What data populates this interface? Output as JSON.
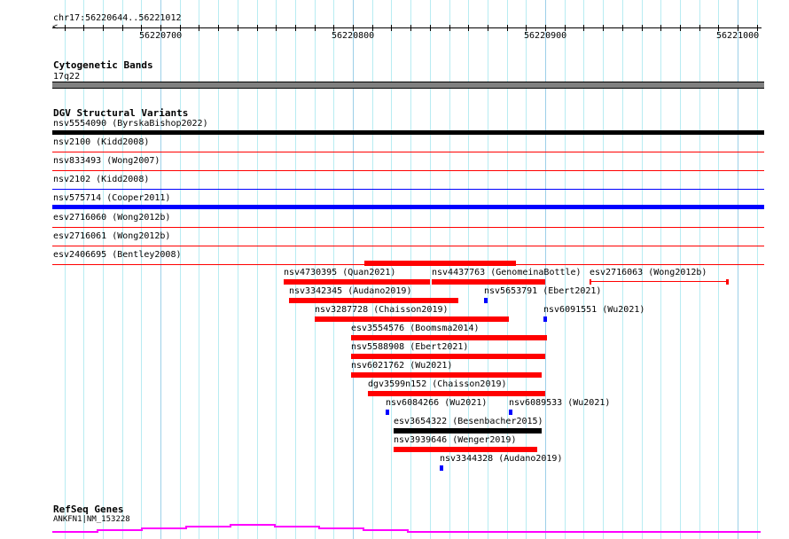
{
  "ruler": {
    "location": "chr17:56220644..56221012",
    "start": 56220644,
    "end": 56221012,
    "labels": [
      "56220700",
      "56220800",
      "56220900",
      "56221000"
    ]
  },
  "cytobands": {
    "title": "Cytogenetic Bands",
    "band": "17q22",
    "color": "#808080"
  },
  "dgv": {
    "title": "DGV Structural Variants",
    "full_rows": [
      {
        "label": "nsv5554090 (ByrskaBishop2022)",
        "color": "#000000",
        "style": "thick"
      },
      {
        "label": "nsv2100 (Kidd2008)",
        "color": "#ff0000",
        "style": "line"
      },
      {
        "label": "nsv833493 (Wong2007)",
        "color": "#ff0000",
        "style": "line"
      },
      {
        "label": "nsv2102 (Kidd2008)",
        "color": "#0000ff",
        "style": "line"
      },
      {
        "label": "nsv575714 (Cooper2011)",
        "color": "#0000ff",
        "style": "thick"
      },
      {
        "label": "esv2716060 (Wong2012b)",
        "color": "#ff0000",
        "style": "line"
      },
      {
        "label": "esv2716061 (Wong2012b)",
        "color": "#ff0000",
        "style": "line"
      },
      {
        "label": "esv2406695 (Bentley2008)",
        "color": "#ff0000",
        "style": "line"
      }
    ],
    "features": [
      {
        "label": "",
        "start": 56220806,
        "end": 56220885,
        "row": -1,
        "color": "#ff0000"
      },
      {
        "label": "nsv4730395 (Quan2021)",
        "start": 56220764,
        "end": 56220840,
        "row": 0,
        "color": "#ff0000"
      },
      {
        "label": "nsv4437763 (GenomeinaBottle)",
        "start": 56220841,
        "end": 56220900,
        "row": 0,
        "color": "#ff0000"
      },
      {
        "label": "esv2716063 (Wong2012b)",
        "start": 56220923,
        "end": 56220995,
        "row": 0,
        "color": "#ff0000",
        "style": "capped"
      },
      {
        "label": "nsv3342345 (Audano2019)",
        "start": 56220767,
        "end": 56220855,
        "row": 1,
        "color": "#ff0000"
      },
      {
        "label": "nsv5653791 (Ebert2021)",
        "start": 56220868,
        "end": 56220870,
        "row": 1,
        "color": "#0000ff"
      },
      {
        "label": "nsv3287728 (Chaisson2019)",
        "start": 56220780,
        "end": 56220881,
        "row": 2,
        "color": "#ff0000"
      },
      {
        "label": "nsv6091551 (Wu2021)",
        "start": 56220899,
        "end": 56220901,
        "row": 2,
        "color": "#0000ff"
      },
      {
        "label": "esv3554576 (Boomsma2014)",
        "start": 56220799,
        "end": 56220901,
        "row": 3,
        "color": "#ff0000"
      },
      {
        "label": "nsv5588908 (Ebert2021)",
        "start": 56220799,
        "end": 56220900,
        "row": 4,
        "color": "#ff0000"
      },
      {
        "label": "nsv6021762 (Wu2021)",
        "start": 56220799,
        "end": 56220898,
        "row": 5,
        "color": "#ff0000"
      },
      {
        "label": "dgv3599n152 (Chaisson2019)",
        "start": 56220808,
        "end": 56220900,
        "row": 6,
        "color": "#ff0000"
      },
      {
        "label": "nsv6084266 (Wu2021)",
        "start": 56220817,
        "end": 56220818,
        "row": 7,
        "color": "#0000ff"
      },
      {
        "label": "nsv6089533 (Wu2021)",
        "start": 56220881,
        "end": 56220883,
        "row": 7,
        "color": "#0000ff"
      },
      {
        "label": "esv3654322 (Besenbacher2015)",
        "start": 56220821,
        "end": 56220898,
        "row": 8,
        "color": "#000000"
      },
      {
        "label": "nsv3939646 (Wenger2019)",
        "start": 56220821,
        "end": 56220896,
        "row": 9,
        "color": "#ff0000"
      },
      {
        "label": "nsv3344328 (Audano2019)",
        "start": 56220845,
        "end": 56220847,
        "row": 10,
        "color": "#0000ff"
      }
    ]
  },
  "refseq": {
    "title": "RefSeq Genes",
    "gene": "ANKFN1|NM_153228",
    "color": "#ff00ff"
  }
}
